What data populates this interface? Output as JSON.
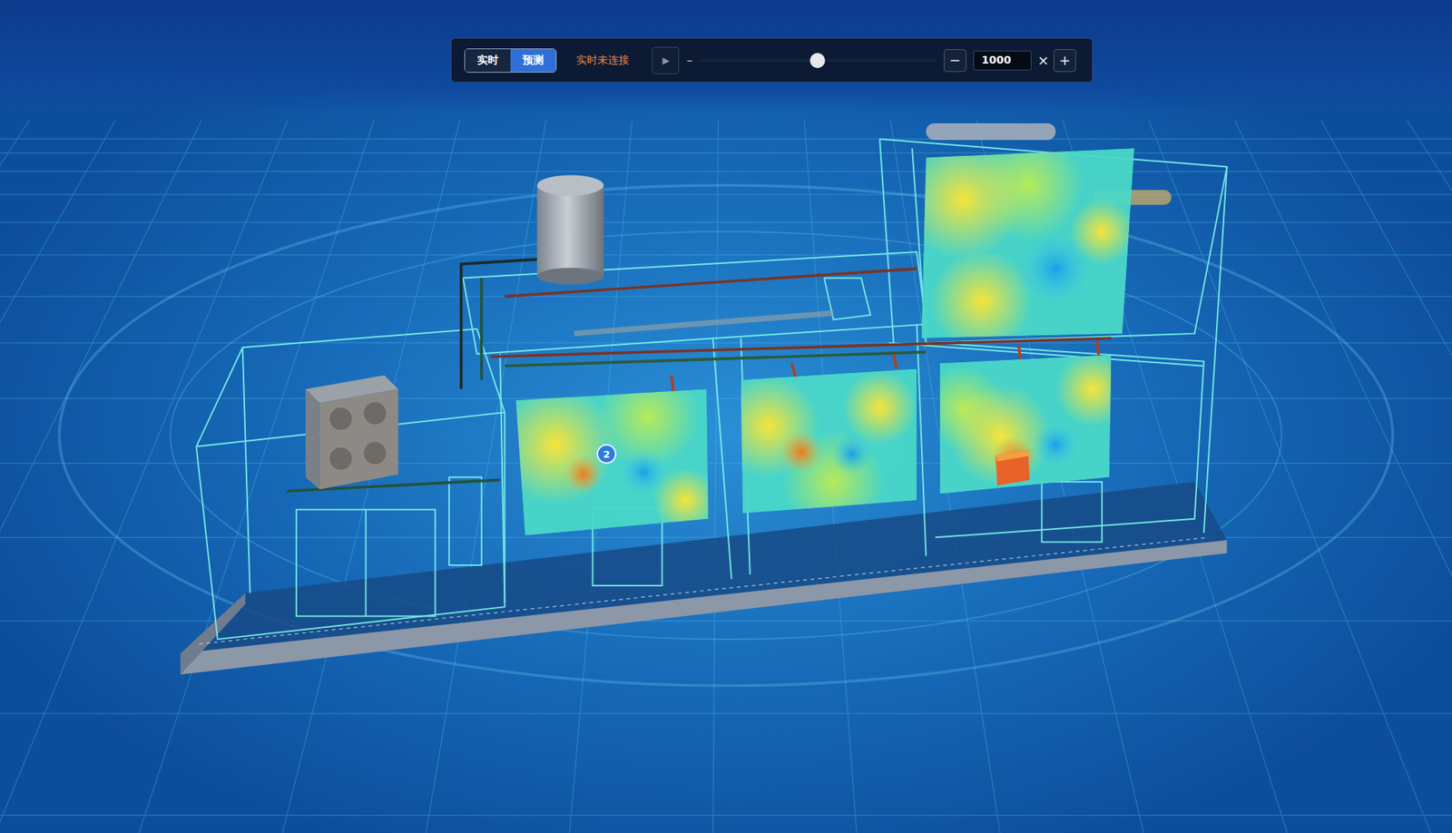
{
  "toolbar": {
    "modes": [
      {
        "label": "实时",
        "selected": false
      },
      {
        "label": "预测",
        "selected": true
      }
    ],
    "connection_status": "实时未连接",
    "play_button": "▶",
    "timeline": {
      "start_mark": "–",
      "level": 0.5
    },
    "speed": {
      "decrease": "−",
      "value": "1000",
      "unit": "×",
      "increase": "+"
    }
  },
  "scene": {
    "markers": [
      {
        "label": "2"
      }
    ]
  }
}
